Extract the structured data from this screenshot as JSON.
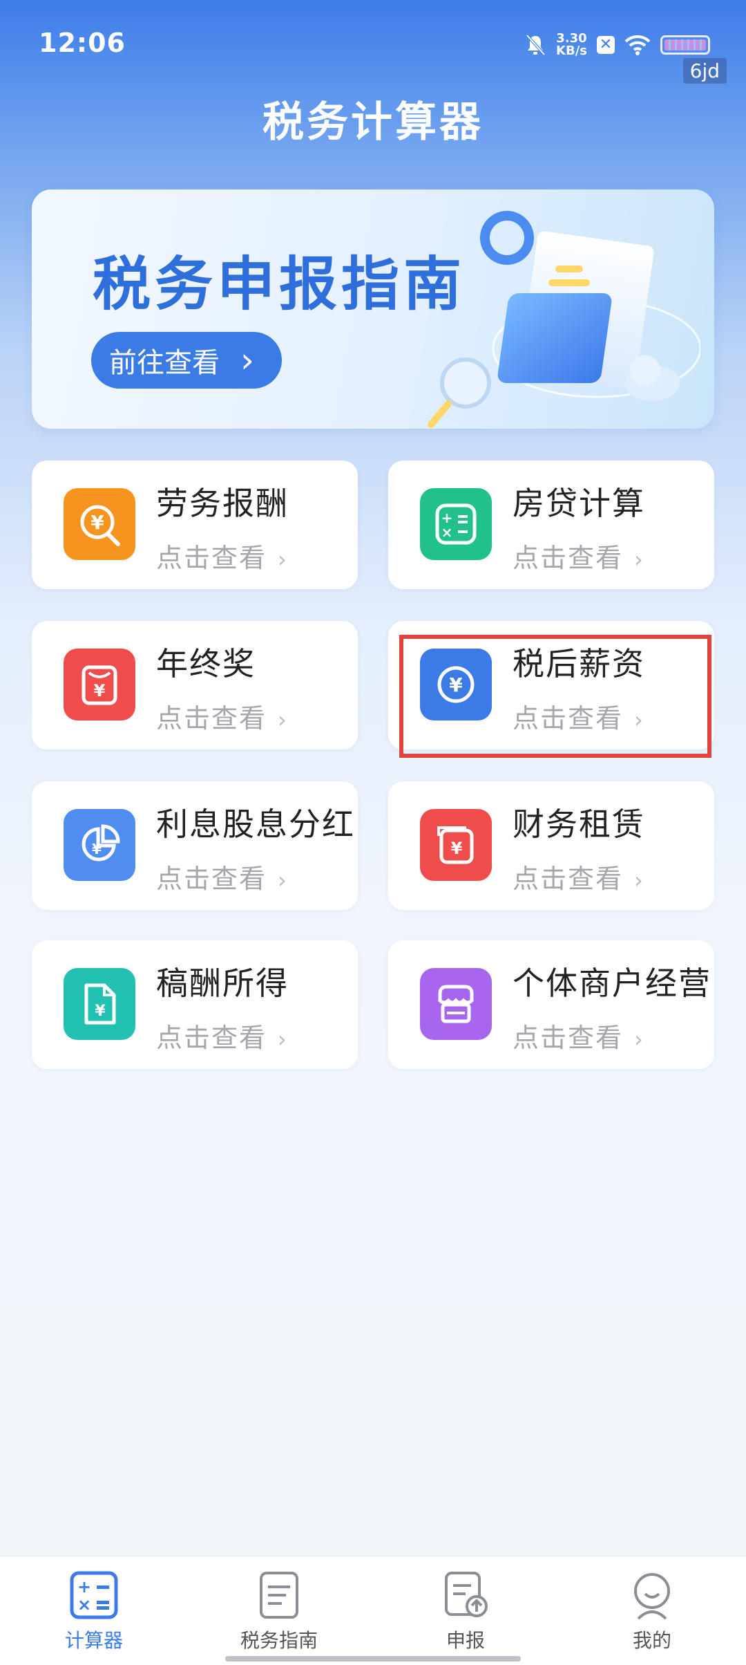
{
  "status_bar": {
    "time": "12:06",
    "net_speed_value": "3.30",
    "net_speed_unit": "KB/s",
    "carrier_tag": "6jd"
  },
  "header": {
    "title": "税务计算器"
  },
  "banner": {
    "title": "税务申报指南",
    "button_label": "前往查看",
    "button_chevron": "›"
  },
  "cards": [
    {
      "title": "劳务报酬",
      "sub": "点击查看",
      "icon": "labor-payment-icon",
      "color": "#f79420"
    },
    {
      "title": "房贷计算",
      "sub": "点击查看",
      "icon": "calculator-icon",
      "color": "#22c08a"
    },
    {
      "title": "年终奖",
      "sub": "点击查看",
      "icon": "bonus-icon",
      "color": "#ef4c4c"
    },
    {
      "title": "税后薪资",
      "sub": "点击查看",
      "icon": "yuan-coin-icon",
      "color": "#3a7be6"
    },
    {
      "title": "利息股息分红",
      "sub": "点击查看",
      "icon": "pie-yuan-icon",
      "color": "#4f8ef0"
    },
    {
      "title": "财务租赁",
      "sub": "点击查看",
      "icon": "lease-icon",
      "color": "#ef4c4c"
    },
    {
      "title": "稿酬所得",
      "sub": "点击查看",
      "icon": "document-yuan-icon",
      "color": "#22c0b0"
    },
    {
      "title": "个体商户经营",
      "sub": "点击查看",
      "icon": "store-icon",
      "color": "#a866ee"
    }
  ],
  "chevron": "›",
  "bottom_nav": [
    {
      "label": "计算器",
      "icon": "calculator-icon",
      "active": true
    },
    {
      "label": "税务指南",
      "icon": "guide-icon",
      "active": false
    },
    {
      "label": "申报",
      "icon": "declare-icon",
      "active": false
    },
    {
      "label": "我的",
      "icon": "profile-icon",
      "active": false
    }
  ],
  "colors": {
    "accent": "#3a7be6",
    "highlight": "#e0453d"
  }
}
